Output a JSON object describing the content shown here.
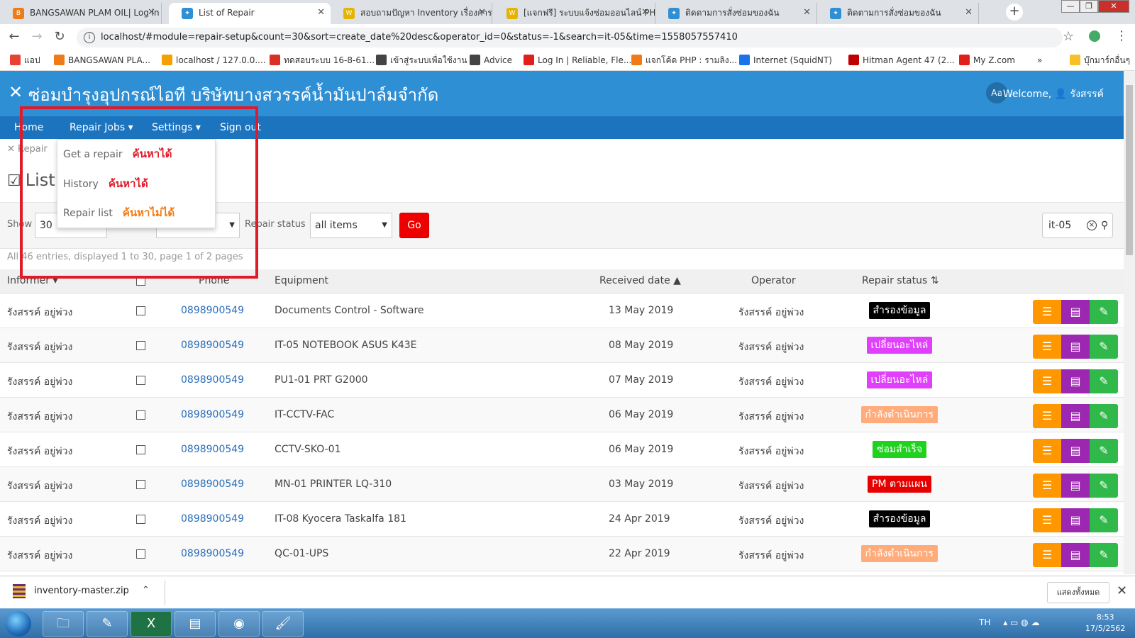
{
  "browser": {
    "tabs": [
      {
        "title": "BANGSAWAN PLAM OIL| Log in",
        "icon_color": "#f07b16",
        "icon_text": "B",
        "active": false
      },
      {
        "title": "List of Repair",
        "icon_color": "#2f8fd5",
        "icon_text": "✦",
        "active": true
      },
      {
        "title": "สอบถามปัญหา Inventory เรื่องการค้",
        "icon_color": "#e5b400",
        "icon_text": "W",
        "active": false
      },
      {
        "title": "[แจกฟรี] ระบบแจ้งซ่อมออนไลน์ PH",
        "icon_color": "#e5b400",
        "icon_text": "W",
        "active": false
      },
      {
        "title": "ติดตามการสั่งซ่อมของฉัน",
        "icon_color": "#2f8fd5",
        "icon_text": "✦",
        "active": false
      },
      {
        "title": "ติดตามการสั่งซ่อมของฉัน",
        "icon_color": "#2f8fd5",
        "icon_text": "✦",
        "active": false
      }
    ],
    "url": "localhost/#module=repair-setup&count=30&sort=create_date%20desc&operator_id=0&status=-1&search=it-05&time=1558057557410",
    "bookmarks": [
      {
        "label": "แอป",
        "icon_color": "#e94235"
      },
      {
        "label": "BANGSAWAN PLA...",
        "icon_color": "#f07b16"
      },
      {
        "label": "localhost / 127.0.0....",
        "icon_color": "#f4a000"
      },
      {
        "label": "ทดสอบระบบ 16-8-61...",
        "icon_color": "#d93025"
      },
      {
        "label": "เข้าสู่ระบบเพื่อใช้งาน",
        "icon_color": "#444444"
      },
      {
        "label": "Advice",
        "icon_color": "#444444"
      },
      {
        "label": "Log In | Reliable, Fle...",
        "icon_color": "#e0201b"
      },
      {
        "label": "แจกโค้ด PHP : รามลิง...",
        "icon_color": "#f07b16"
      },
      {
        "label": "Internet (SquidNT)",
        "icon_color": "#1a73e8"
      },
      {
        "label": "Hitman Agent 47 (2...",
        "icon_color": "#c00000"
      },
      {
        "label": "My Z.com",
        "icon_color": "#e0201b"
      },
      {
        "label": "บุ๊กมาร์กอื่นๆ",
        "icon_color": "#f6c026"
      }
    ],
    "more_bookmarks": "»"
  },
  "app": {
    "title": "ซ่อมบำรุงอุปกรณ์ไอที บริษัทบางสวรรค์น้ำมันปาล์มจำกัด",
    "lang": "Aอ",
    "welcome": "Welcome, 👤 รังสรรค์",
    "nav": {
      "home": "Home",
      "repair_jobs": "Repair Jobs ▾",
      "settings": "Settings ▾",
      "signout": "Sign out"
    },
    "dropdown": [
      {
        "label": "Get a repair",
        "note": "ค้นหาได้",
        "note_color": "#e01a28"
      },
      {
        "label": "History",
        "note": "ค้นหาได้",
        "note_color": "#e01a28"
      },
      {
        "label": "Repair list",
        "note": "ค้นหาไม่ได้",
        "note_color": "#f07b16"
      }
    ],
    "breadcrumb": "Repair",
    "page_title": "List of Repair",
    "filters": {
      "show_label": "Show",
      "show_value": "30",
      "repair_status_label": "Repair status",
      "repair_status_value": "all items",
      "go_label": "Go",
      "search_value": "it-05"
    },
    "entries_info": "All 46 entries, displayed 1 to 30, page 1 of 2 pages",
    "columns": {
      "informer": "Informer ▾",
      "phone": "Phone",
      "equipment": "Equipment",
      "received_date": "Received date ▲",
      "operator": "Operator",
      "repair_status": "Repair status ⇅"
    },
    "rows": [
      {
        "informer": "รังสรรค์ อยู่พ่วง",
        "phone": "0898900549",
        "equipment": "Documents Control - Software",
        "date": "13 May 2019",
        "operator": "รังสรรค์ อยู่พ่วง",
        "status": "สำรองข้อมูล",
        "status_color": "#000000"
      },
      {
        "informer": "รังสรรค์ อยู่พ่วง",
        "phone": "0898900549",
        "equipment": "IT-05 NOTEBOOK ASUS K43E",
        "date": "08 May 2019",
        "operator": "รังสรรค์ อยู่พ่วง",
        "status": "เปลี่ยนอะไหล่",
        "status_color": "#e040fb"
      },
      {
        "informer": "รังสรรค์ อยู่พ่วง",
        "phone": "0898900549",
        "equipment": "PU1-01 PRT G2000",
        "date": "07 May 2019",
        "operator": "รังสรรค์ อยู่พ่วง",
        "status": "เปลี่ยนอะไหล่",
        "status_color": "#e040fb"
      },
      {
        "informer": "รังสรรค์ อยู่พ่วง",
        "phone": "0898900549",
        "equipment": "IT-CCTV-FAC",
        "date": "06 May 2019",
        "operator": "รังสรรค์ อยู่พ่วง",
        "status": "กำลังดำเนินการ",
        "status_color": "#ffab7a"
      },
      {
        "informer": "รังสรรค์ อยู่พ่วง",
        "phone": "0898900549",
        "equipment": "CCTV-SKO-01",
        "date": "06 May 2019",
        "operator": "รังสรรค์ อยู่พ่วง",
        "status": "ซ่อมสำเร็จ",
        "status_color": "#1ed21e"
      },
      {
        "informer": "รังสรรค์ อยู่พ่วง",
        "phone": "0898900549",
        "equipment": "MN-01 PRINTER LQ-310",
        "date": "03 May 2019",
        "operator": "รังสรรค์ อยู่พ่วง",
        "status": "PM ตามแผน",
        "status_color": "#e60000"
      },
      {
        "informer": "รังสรรค์ อยู่พ่วง",
        "phone": "0898900549",
        "equipment": "IT-08 Kyocera Taskalfa 181",
        "date": "24 Apr 2019",
        "operator": "รังสรรค์ อยู่พ่วง",
        "status": "สำรองข้อมูล",
        "status_color": "#000000"
      },
      {
        "informer": "รังสรรค์ อยู่พ่วง",
        "phone": "0898900549",
        "equipment": "QC-01-UPS",
        "date": "22 Apr 2019",
        "operator": "รังสรรค์ อยู่พ่วง",
        "status": "กำลังดำเนินการ",
        "status_color": "#ffab7a"
      }
    ]
  },
  "download": {
    "file": "inventory-master.zip",
    "show_all": "แสดงทั้งหมด"
  },
  "taskbar": {
    "lang": "TH",
    "time": "8:53",
    "date": "17/5/2562"
  }
}
